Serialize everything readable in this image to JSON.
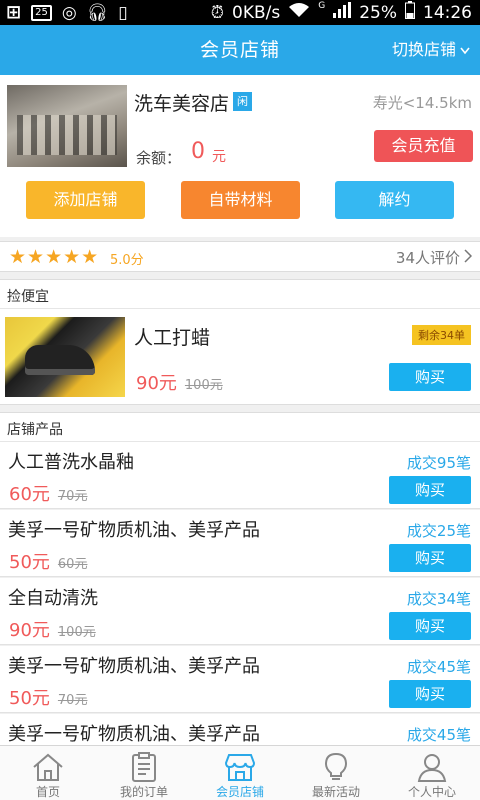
{
  "status_bar": {
    "badge": "25",
    "net_speed": "0KB/s",
    "network_type": "G",
    "battery": "25%",
    "time": "14:26"
  },
  "header": {
    "title": "会员店铺",
    "switch_label": "切换店铺"
  },
  "shop": {
    "name": "洗车美容店",
    "tag": "闲",
    "distance": "寿光<14.5km",
    "balance_label": "余额：",
    "balance_value": "0",
    "balance_unit": "元",
    "recharge_label": "会员充值",
    "actions": {
      "add": "添加店铺",
      "material": "自带材料",
      "cancel": "解约"
    }
  },
  "rating": {
    "stars": "★★★★★",
    "score": "5.0分",
    "review_count": "34人评价"
  },
  "deal_section": {
    "title": "捡便宜",
    "item": {
      "name": "人工打蜡",
      "remaining": "剩余34单",
      "price": "90元",
      "original_price": "100元",
      "buy_label": "购买"
    }
  },
  "products_section": {
    "title": "店铺产品",
    "items": [
      {
        "name": "人工普洗水晶釉",
        "sold": "成交95笔",
        "price": "60元",
        "original_price": "70元",
        "buy_label": "购买"
      },
      {
        "name": "美孚一号矿物质机油、美孚产品",
        "sold": "成交25笔",
        "price": "50元",
        "original_price": "60元",
        "buy_label": "购买"
      },
      {
        "name": "全自动清洗",
        "sold": "成交34笔",
        "price": "90元",
        "original_price": "100元",
        "buy_label": "购买"
      },
      {
        "name": "美孚一号矿物质机油、美孚产品",
        "sold": "成交45笔",
        "price": "50元",
        "original_price": "70元",
        "buy_label": "购买"
      },
      {
        "name": "美孚一号矿物质机油、美孚产品",
        "sold": "成交45笔",
        "price": "",
        "original_price": "",
        "buy_label": ""
      }
    ]
  },
  "tabbar": {
    "items": [
      {
        "label": "首页",
        "icon": "home-icon"
      },
      {
        "label": "我的订单",
        "icon": "orders-icon"
      },
      {
        "label": "会员店铺",
        "icon": "store-icon"
      },
      {
        "label": "最新活动",
        "icon": "lightbulb-icon"
      },
      {
        "label": "个人中心",
        "icon": "user-icon"
      }
    ]
  },
  "colors": {
    "primary": "#2aa8e8",
    "price_red": "#f05a5a",
    "recharge": "#ef5457",
    "add": "#f9b62b",
    "material": "#f7862f",
    "cancel": "#35b8f2",
    "star": "#f6a623"
  }
}
